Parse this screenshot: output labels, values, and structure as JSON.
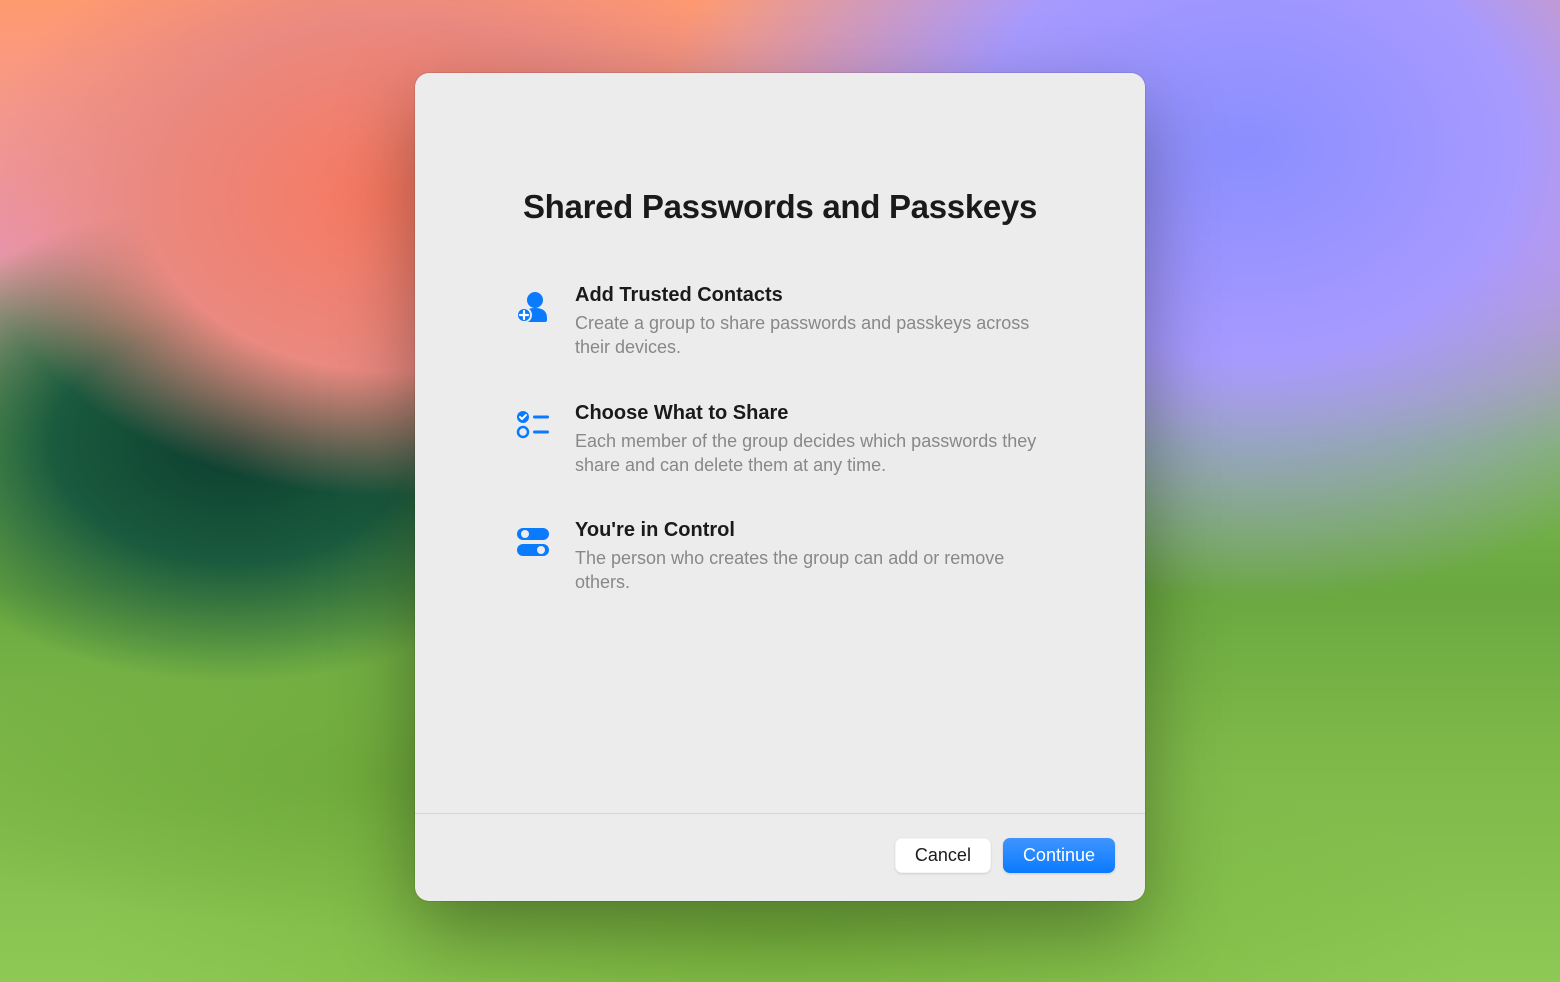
{
  "dialog": {
    "title": "Shared Passwords and Passkeys",
    "features": [
      {
        "title": "Add Trusted Contacts",
        "description": "Create a group to share passwords and passkeys across their devices."
      },
      {
        "title": "Choose What to Share",
        "description": "Each member of the group decides which passwords they share and can delete them at any time."
      },
      {
        "title": "You're in Control",
        "description": "The person who creates the group can add or remove others."
      }
    ],
    "buttons": {
      "cancel": "Cancel",
      "continue": "Continue"
    }
  }
}
